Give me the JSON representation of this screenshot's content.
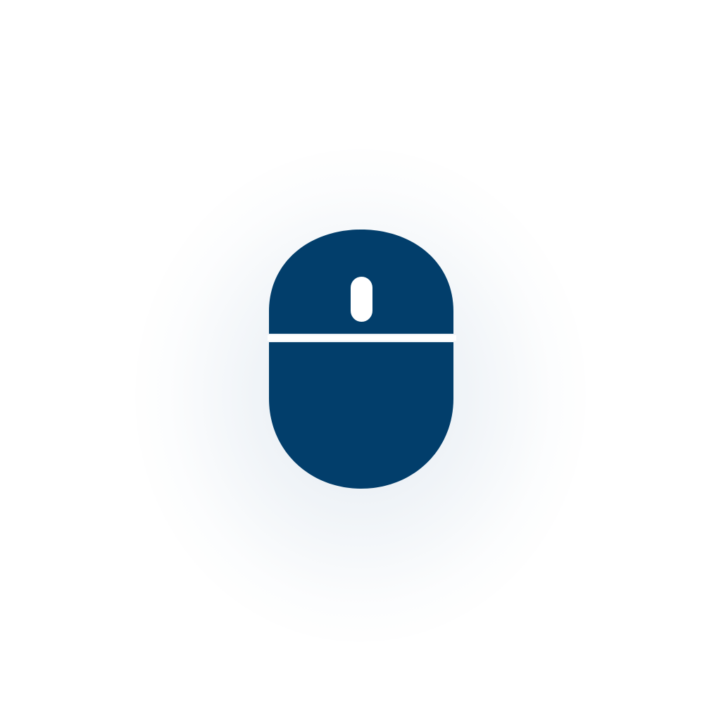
{
  "icon": {
    "name": "computer-mouse-icon",
    "body_color": "#023E6B",
    "accent_color": "#FFFFFF",
    "background_color": "#FFFFFF"
  }
}
